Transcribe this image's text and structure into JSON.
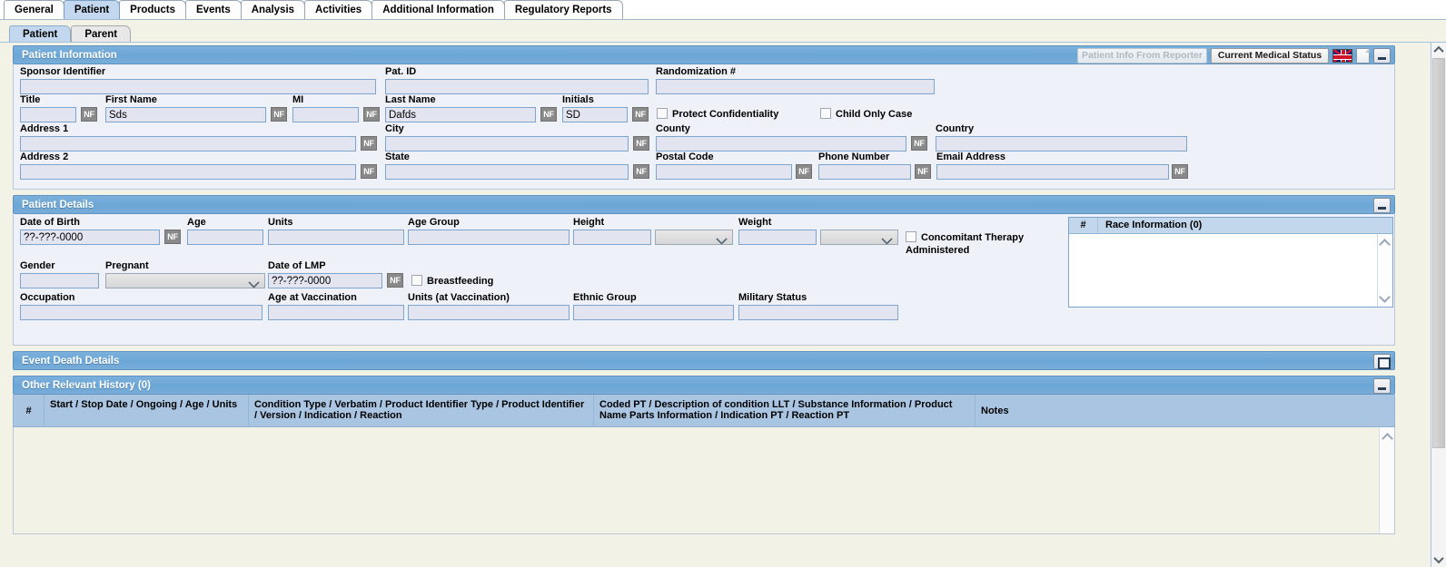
{
  "tabs": [
    {
      "label": "General",
      "active": false
    },
    {
      "label": "Patient",
      "active": true
    },
    {
      "label": "Products",
      "active": false
    },
    {
      "label": "Events",
      "active": false
    },
    {
      "label": "Analysis",
      "active": false
    },
    {
      "label": "Activities",
      "active": false
    },
    {
      "label": "Additional Information",
      "active": false
    },
    {
      "label": "Regulatory Reports",
      "active": false
    }
  ],
  "subtabs": [
    {
      "label": "Patient",
      "active": true
    },
    {
      "label": "Parent",
      "active": false
    }
  ],
  "patient_information": {
    "title": "Patient Information",
    "buttons": {
      "patient_info_from_reporter": "Patient Info From Reporter",
      "current_medical_status": "Current Medical Status"
    },
    "icons": {
      "flag": "uk-flag-icon",
      "document": "document-icon",
      "minimize": "minimize-icon"
    },
    "fields": {
      "sponsor_identifier": {
        "label": "Sponsor Identifier",
        "value": ""
      },
      "pat_id": {
        "label": "Pat. ID",
        "value": ""
      },
      "randomization": {
        "label": "Randomization #",
        "value": ""
      },
      "title": {
        "label": "Title",
        "value": ""
      },
      "first_name": {
        "label": "First Name",
        "value": "Sds"
      },
      "mi": {
        "label": "MI",
        "value": ""
      },
      "last_name": {
        "label": "Last Name",
        "value": "Dafds"
      },
      "initials": {
        "label": "Initials",
        "value": "SD"
      },
      "address_1": {
        "label": "Address 1",
        "value": ""
      },
      "address_2": {
        "label": "Address 2",
        "value": ""
      },
      "city": {
        "label": "City",
        "value": ""
      },
      "state": {
        "label": "State",
        "value": ""
      },
      "county": {
        "label": "County",
        "value": ""
      },
      "country": {
        "label": "Country",
        "value": ""
      },
      "postal_code": {
        "label": "Postal Code",
        "value": ""
      },
      "phone_number": {
        "label": "Phone Number",
        "value": ""
      },
      "email_address": {
        "label": "Email Address",
        "value": ""
      }
    },
    "checkboxes": {
      "protect_confidentiality": {
        "label": "Protect Confidentiality",
        "checked": false
      },
      "child_only_case": {
        "label": "Child Only Case",
        "checked": false
      }
    },
    "nf_label": "NF"
  },
  "patient_details": {
    "title": "Patient Details",
    "fields": {
      "date_of_birth": {
        "label": "Date of Birth",
        "value": "??-???-0000"
      },
      "age": {
        "label": "Age",
        "value": ""
      },
      "units": {
        "label": "Units",
        "value": ""
      },
      "age_group": {
        "label": "Age Group",
        "value": ""
      },
      "height": {
        "label": "Height",
        "value": ""
      },
      "height_unit": {
        "label": "",
        "value": ""
      },
      "weight": {
        "label": "Weight",
        "value": ""
      },
      "weight_unit": {
        "label": "",
        "value": ""
      },
      "gender": {
        "label": "Gender",
        "value": ""
      },
      "pregnant": {
        "label": "Pregnant",
        "value": ""
      },
      "date_of_lmp": {
        "label": "Date of LMP",
        "value": "??-???-0000"
      },
      "occupation": {
        "label": "Occupation",
        "value": ""
      },
      "age_at_vaccination": {
        "label": "Age at Vaccination",
        "value": ""
      },
      "units_at_vaccination": {
        "label": "Units (at Vaccination)",
        "value": ""
      },
      "ethnic_group": {
        "label": "Ethnic Group",
        "value": ""
      },
      "military_status": {
        "label": "Military Status",
        "value": ""
      }
    },
    "checkboxes": {
      "concomitant_therapy": {
        "label": "Concomitant Therapy Administered",
        "checked": false
      },
      "breastfeeding": {
        "label": "Breastfeeding",
        "checked": false
      }
    },
    "race_panel": {
      "num_header": "#",
      "title": "Race Information (0)",
      "rows": []
    },
    "nf_label": "NF"
  },
  "event_death_details": {
    "title": "Event Death Details",
    "icon": "restore-icon"
  },
  "other_relevant_history": {
    "title": "Other Relevant History (0)",
    "icon": "minimize-icon",
    "columns": [
      "#",
      "Start / Stop Date / Ongoing / Age / Units",
      "Condition Type / Verbatim / Product Identifier Type / Product Identifier / Version / Indication / Reaction",
      "Coded PT / Description of condition LLT / Substance Information / Product Name Parts Information / Indication PT / Reaction PT",
      "Notes"
    ],
    "rows": []
  },
  "colors": {
    "section_header": "#6ba6d6",
    "page_background": "#f2f2e6",
    "field_background": "#e2e5f0",
    "field_border": "#7ca4cc",
    "active_tab": "#c3d8ee",
    "grid_header": "#a9c5e2"
  }
}
